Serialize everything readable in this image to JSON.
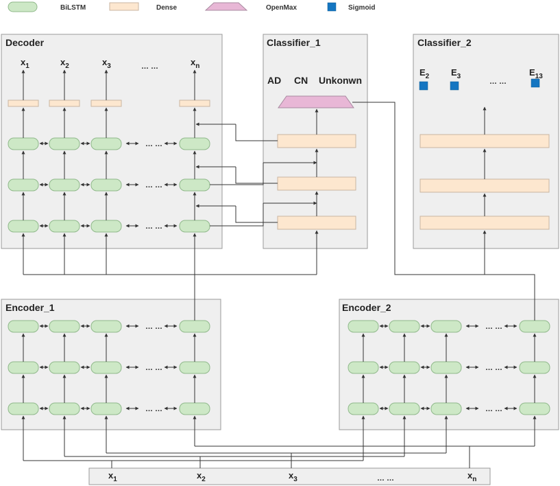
{
  "legend": {
    "bilstm": "BiLSTM",
    "dense": "Dense",
    "openmax": "OpenMax",
    "sigmoid": "Sigmoid"
  },
  "panels": {
    "decoder": "Decoder",
    "classifier1": "Classifier_1",
    "classifier2": "Classifier_2",
    "encoder1": "Encoder_1",
    "encoder2": "Encoder_2"
  },
  "variable": "x",
  "subscripts": [
    "1",
    "2",
    "3",
    "n"
  ],
  "ellipsis": "… …",
  "classifier1_labels": [
    "AD",
    "CN",
    "Unkonwn"
  ],
  "classifier2_outputs": {
    "letter": "E",
    "subscripts": [
      "2",
      "3",
      "13"
    ]
  },
  "colors": {
    "bilstm": "#cde8c6",
    "dense": "#fde7cf",
    "openmax": "#e8b7d6",
    "sigmoid": "#1576c1",
    "panel": "#efefef"
  }
}
